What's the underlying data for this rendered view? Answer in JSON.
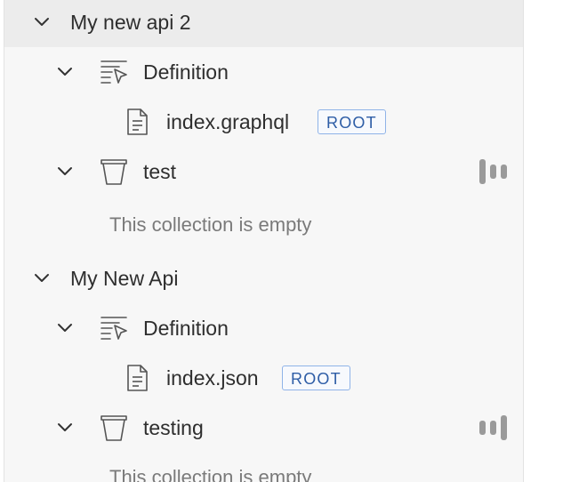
{
  "tree": {
    "apis": [
      {
        "name": "My new api 2",
        "definition_label": "Definition",
        "file": "index.graphql",
        "file_badge": "ROOT",
        "collection": "test",
        "empty_text": "This collection is empty"
      },
      {
        "name": "My New Api",
        "definition_label": "Definition",
        "file": "index.json",
        "file_badge": "ROOT",
        "collection": "testing",
        "empty_text": "This collection is empty"
      }
    ]
  },
  "icons": {
    "expand": "chevron-down-icon",
    "definition": "definition-list-icon",
    "file": "document-icon",
    "collection": "collection-bucket-icon",
    "status": "bars-status-icon"
  },
  "colors": {
    "panel_bg": "#f7f7f7",
    "selected_row_bg": "#ececec",
    "badge_border": "#8fb3e8",
    "badge_text": "#2e5da6",
    "muted_text": "#7a7a7a"
  }
}
